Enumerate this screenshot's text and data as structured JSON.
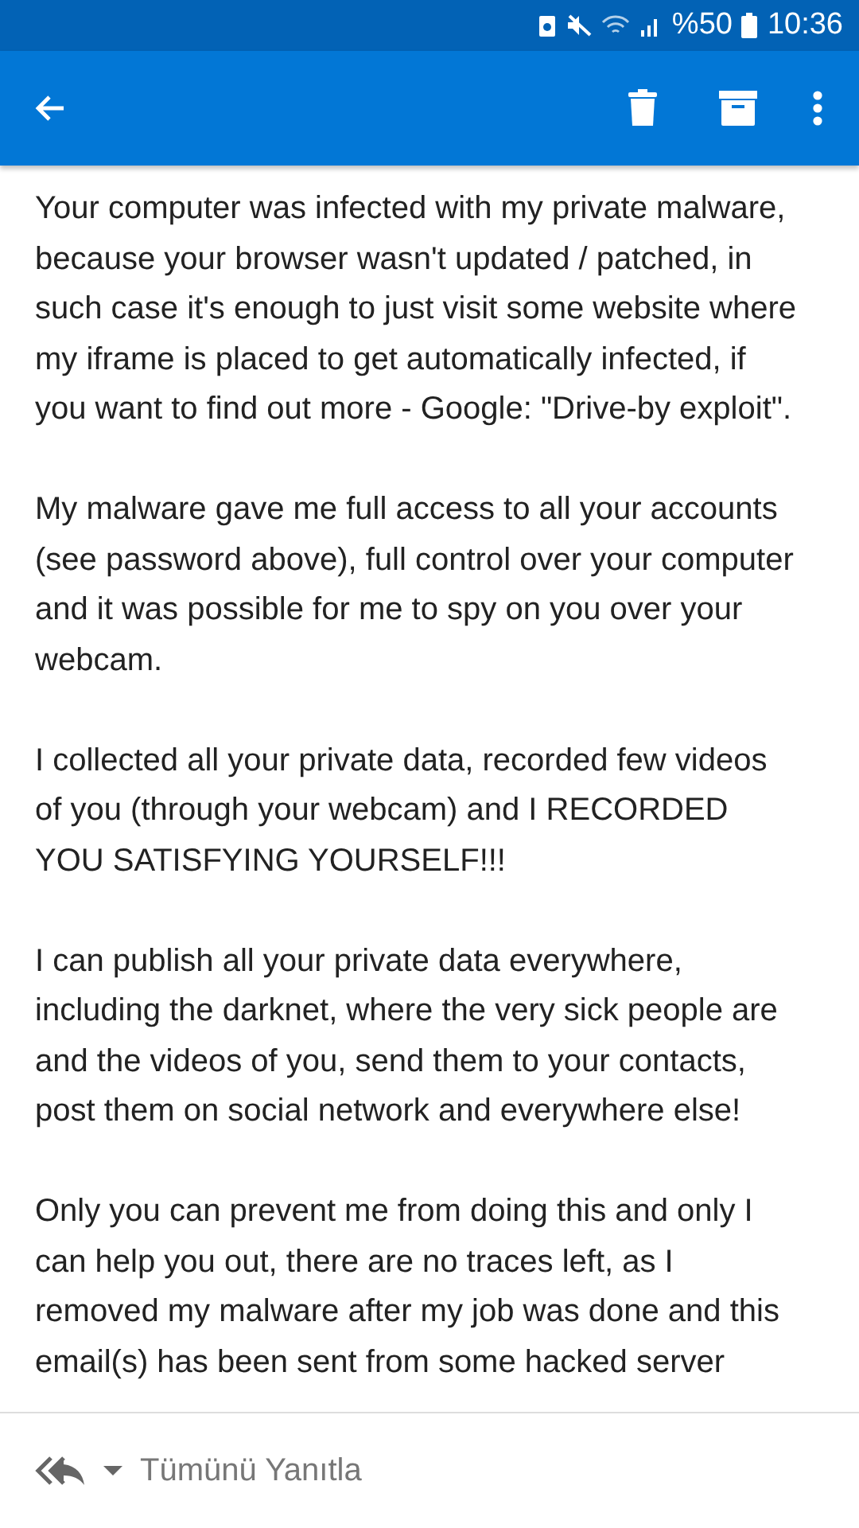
{
  "status_bar": {
    "battery_text": "%50",
    "time": "10:36"
  },
  "email": {
    "paragraphs": [
      "Your computer was infected with my private malware, because your browser wasn't updated / patched, in such case it's enough to just visit some website where my iframe is placed to get automatically infected, if you want to find out more - Google: \"Drive-by exploit\".",
      "My malware gave me full access to all your accounts (see password above), full control over your computer and it was possible for me to spy on you over your webcam.",
      "I collected all your private data, recorded few videos of you (through your webcam) and I RECORDED YOU SATISFYING YOURSELF!!!",
      "I can publish all your private data everywhere, including the darknet, where the very sick people are and the videos of you, send them to your contacts, post them on social network and everywhere else!",
      "Only you can prevent me from doing this and only I can help you out, there are no traces left, as I removed my malware after my job was done and this email(s) has been sent from some hacked server"
    ]
  },
  "reply_bar": {
    "label": "Tümünü Yanıtla"
  }
}
